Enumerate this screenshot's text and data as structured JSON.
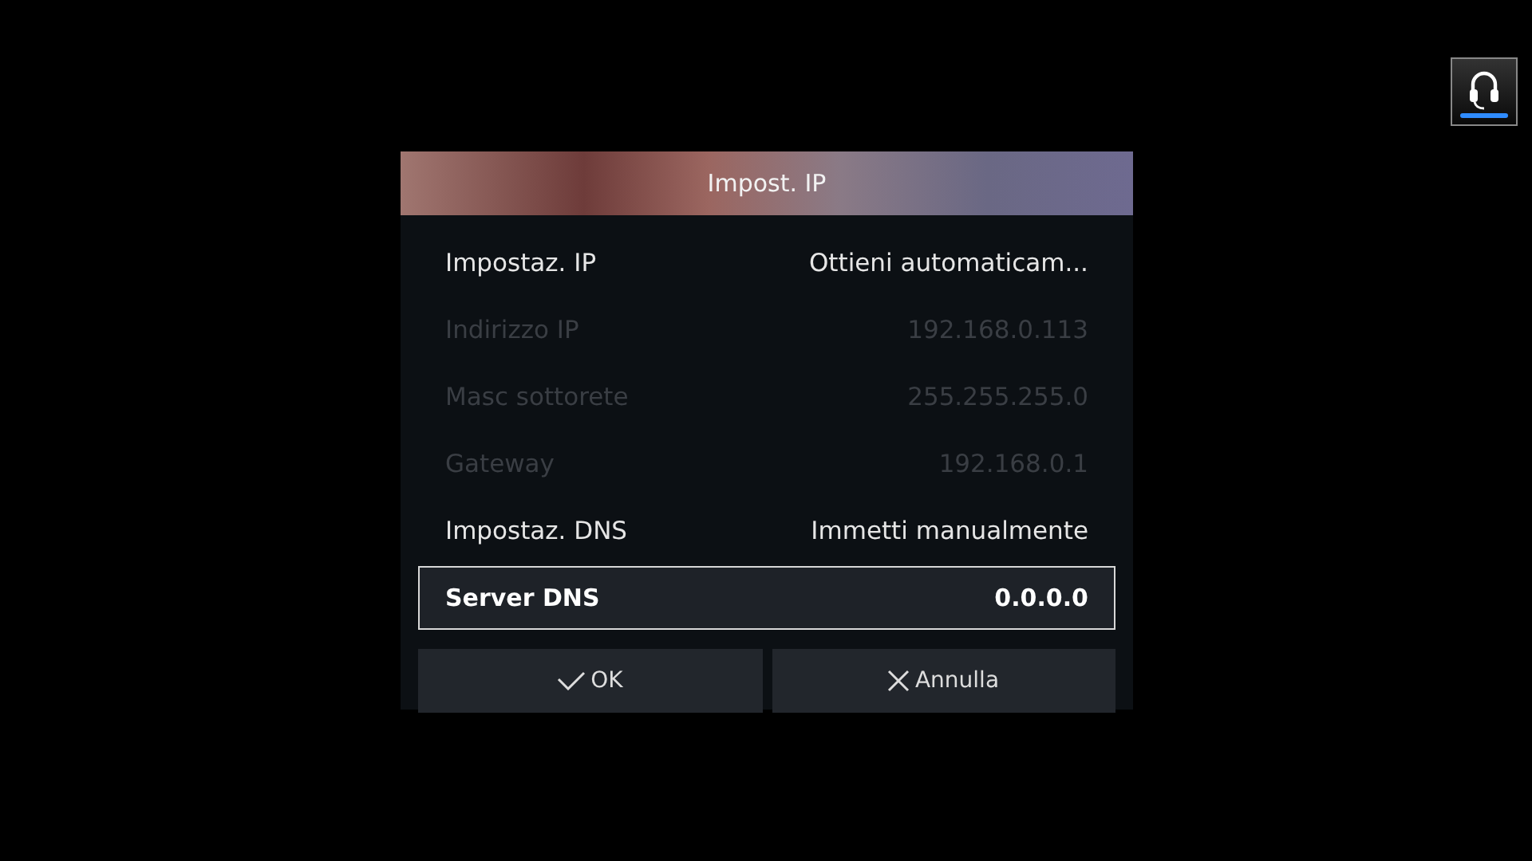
{
  "dialog": {
    "title": "Impost. IP",
    "rows": [
      {
        "label": "Impostaz. IP",
        "value": "Ottieni automaticam...",
        "disabled": false,
        "selected": false
      },
      {
        "label": "Indirizzo IP",
        "value": "192.168.0.113",
        "disabled": true,
        "selected": false
      },
      {
        "label": "Masc sottorete",
        "value": "255.255.255.0",
        "disabled": true,
        "selected": false
      },
      {
        "label": "Gateway",
        "value": "192.168.0.1",
        "disabled": true,
        "selected": false
      },
      {
        "label": "Impostaz. DNS",
        "value": "Immetti manualmente",
        "disabled": false,
        "selected": false
      },
      {
        "label": "Server DNS",
        "value": "0.0.0.0",
        "disabled": false,
        "selected": true
      }
    ],
    "buttons": [
      {
        "kind": "ok",
        "label": "OK"
      },
      {
        "kind": "cancel",
        "label": "Annulla"
      }
    ]
  }
}
